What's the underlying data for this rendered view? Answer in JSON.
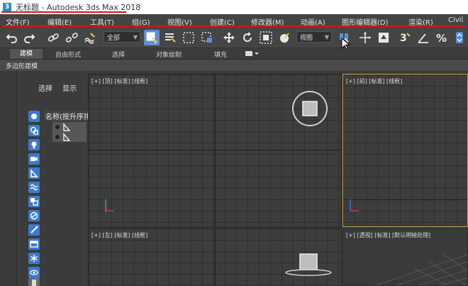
{
  "window": {
    "app_icon_glyph": "3",
    "title": "无标题 - Autodesk 3ds Max 2018"
  },
  "menu": {
    "items": [
      "文件(F)",
      "编辑(E)",
      "工具(T)",
      "组(G)",
      "视图(V)",
      "创建(C)",
      "修改器(M)",
      "动画(A)",
      "图形编辑器(D)",
      "渲染(R)",
      "Civil"
    ]
  },
  "toolbar": {
    "selection_filter": "全部",
    "reference_coord": "视图",
    "icons": [
      "undo-icon",
      "redo-icon",
      "link-icon",
      "unlink-icon",
      "bind-space-warp-icon",
      "select-object-icon",
      "select-by-name-icon",
      "rect-select-region-icon",
      "window-crossing-icon",
      "move-icon",
      "rotate-icon",
      "scale-icon",
      "placement-icon",
      "pivot-icon",
      "snap-3d-icon",
      "angle-snap-icon",
      "percent-snap-icon",
      "spinner-snap-icon"
    ]
  },
  "ribbon": {
    "tabs": [
      "建模",
      "自由形式",
      "选择",
      "对象绘制",
      "填充"
    ],
    "active_tab": "建模",
    "sub_label": "多边形建模"
  },
  "scene_explorer": {
    "tabs": [
      "选择",
      "显示"
    ],
    "column_header": "名称(按升序排"
  },
  "viewports": {
    "top": "[+] [顶] [标准] [线框]",
    "front": "[+] [前] [标准] [线框]",
    "left": "[+] [左] [标准] [线框]",
    "perspective": "[+] [透视] [标准] [默认明暗处理]"
  },
  "colors": {
    "annotation_red": "#d4141b",
    "active_viewport_border": "#c9a246",
    "tool_active_blue": "#5b8fd6"
  }
}
